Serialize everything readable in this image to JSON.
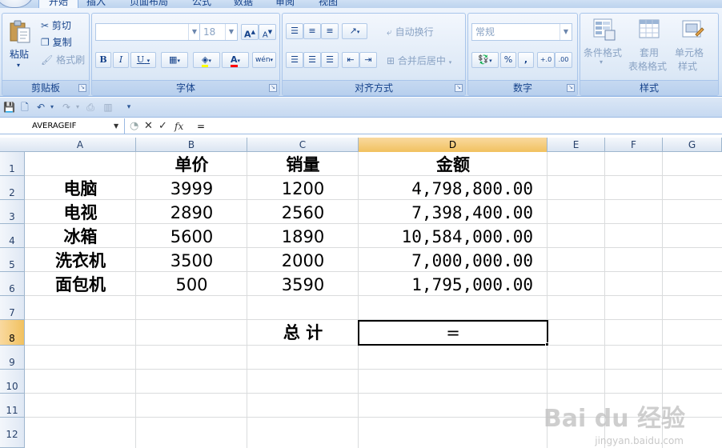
{
  "ribbon": {
    "tabs": [
      "开始",
      "插入",
      "页面布局",
      "公式",
      "数据",
      "审阅",
      "视图"
    ],
    "clipboard": {
      "title": "剪贴板",
      "paste": "粘贴",
      "cut": "剪切",
      "copy": "复制",
      "format_painter": "格式刷"
    },
    "font": {
      "title": "字体",
      "font_name": "",
      "font_size": "18",
      "bold": "B",
      "italic": "I",
      "underline": "U",
      "grow": "A",
      "shrink": "A"
    },
    "alignment": {
      "title": "对齐方式",
      "wrap_text": "自动换行",
      "merge_center": "合并后居中"
    },
    "number": {
      "title": "数字",
      "format": "常规",
      "percent": "%",
      "comma": ","
    },
    "styles": {
      "title": "样式",
      "conditional": "条件格式",
      "table_format_1": "套用",
      "table_format_2": "表格格式",
      "cell_styles_1": "单元格",
      "cell_styles_2": "样式"
    }
  },
  "formula_bar": {
    "name_box": "AVERAGEIF",
    "cancel": "✕",
    "enter": "✓",
    "fx": "fx",
    "content": "="
  },
  "columns": [
    "A",
    "B",
    "C",
    "D",
    "E",
    "F",
    "G"
  ],
  "selected_column": "D",
  "rows": [
    "1",
    "2",
    "3",
    "4",
    "5",
    "6",
    "7",
    "8",
    "9",
    "10",
    "11",
    "12"
  ],
  "selected_row": "8",
  "sheet": {
    "headers": {
      "A": "",
      "B": "单价",
      "C": "销量",
      "D": "金额"
    },
    "data": [
      {
        "A": "电脑",
        "B": "3999",
        "C": "1200",
        "D": "4,798,800.00"
      },
      {
        "A": "电视",
        "B": "2890",
        "C": "2560",
        "D": "7,398,400.00"
      },
      {
        "A": "冰箱",
        "B": "5600",
        "C": "1890",
        "D": "10,584,000.00"
      },
      {
        "A": "洗衣机",
        "B": "3500",
        "C": "2000",
        "D": "7,000,000.00"
      },
      {
        "A": "面包机",
        "B": "500",
        "C": "3590",
        "D": "1,795,000.00"
      }
    ],
    "total_label": "总 计",
    "total_value": "="
  },
  "watermark": {
    "brand": "Bai du 经验",
    "url": "jingyan.baidu.com"
  },
  "colors": {
    "selection_header": "#f1c15f",
    "ribbon": "#dbe8f7",
    "grid_line": "#dadcdd"
  }
}
